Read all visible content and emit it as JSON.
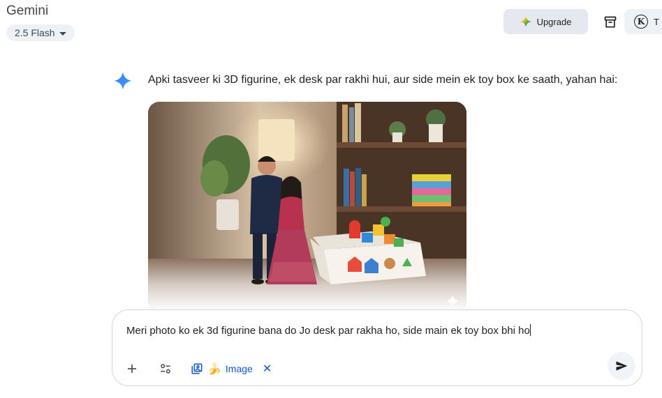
{
  "header": {
    "app_title": "Gemini",
    "model_label": "2.5 Flash",
    "upgrade_label": "Upgrade",
    "account_initial": "K",
    "account_text_partial": "T"
  },
  "conversation": {
    "response_text": "Apki tasveer ki 3D figurine, ek desk par rakhi hui, aur side mein ek toy box ke saath, yahan hai:"
  },
  "composer": {
    "input_value": "Meri photo ko ek 3d figurine bana do Jo desk par rakha ho, side main ek toy box bhi ho",
    "image_chip_label": "Image"
  },
  "icons": {
    "gemini": "gemini-spark-icon",
    "upgrade": "gemini-color-spark-icon",
    "archive": "archive-icon",
    "add": "plus-icon",
    "tools": "tools-icon",
    "image_tool": "image-tool-icon",
    "banana": "banana-icon",
    "close": "close-icon",
    "send": "send-icon"
  },
  "colors": {
    "accent": "#0b57d0",
    "gemini_blue": "#4285f4",
    "pill_bg": "#eef1f5"
  }
}
